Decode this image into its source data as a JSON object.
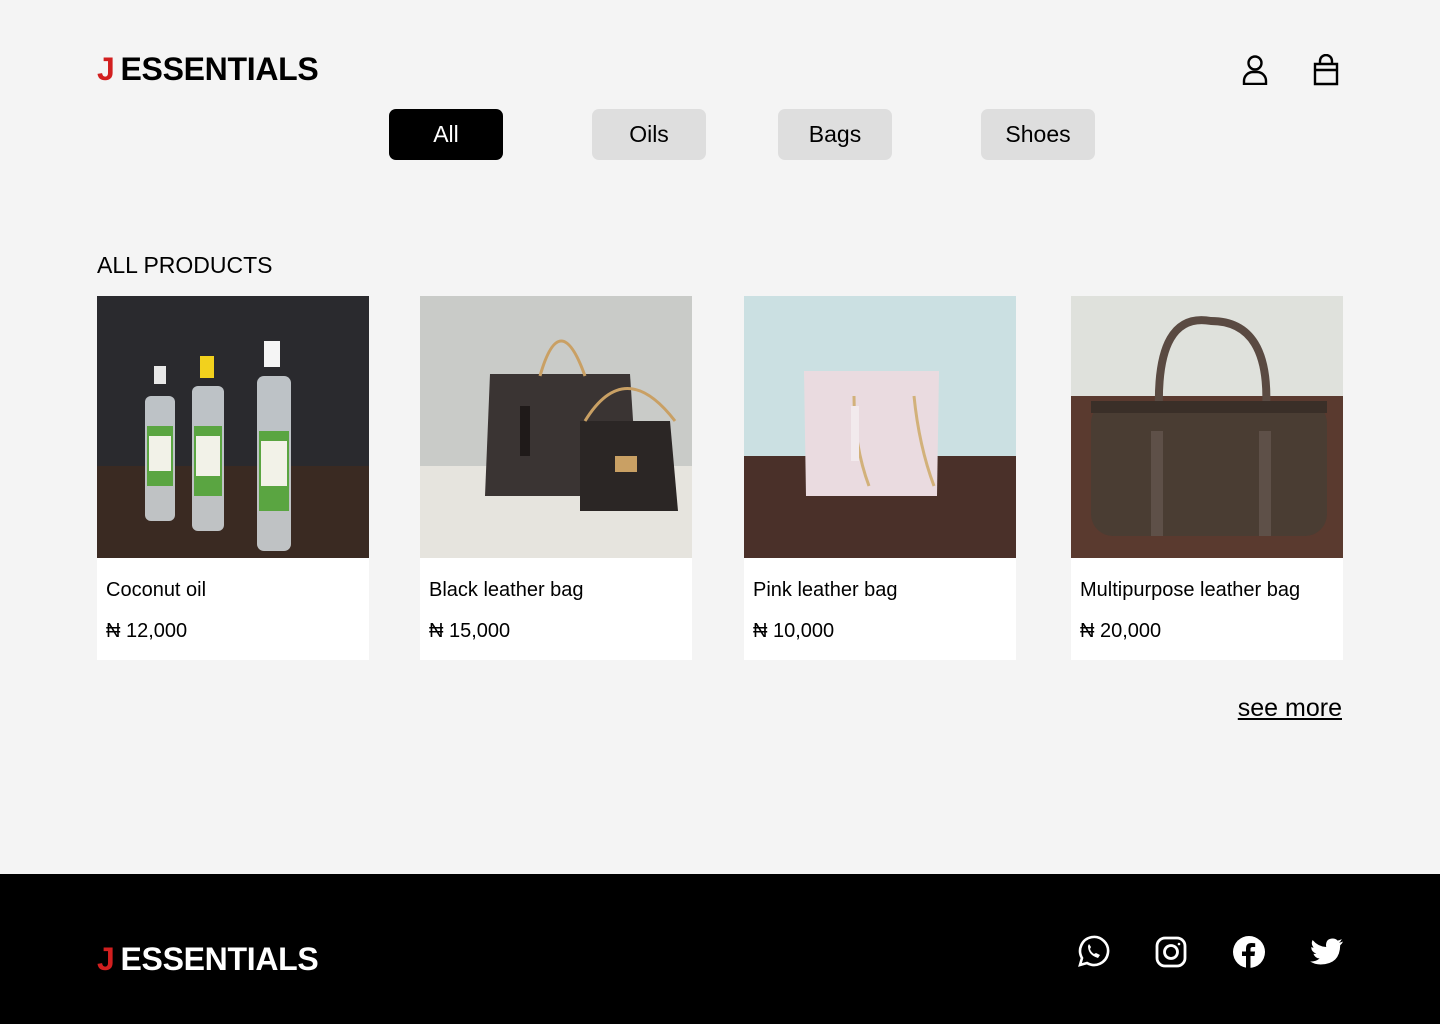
{
  "brand": {
    "initial": "J",
    "name": "ESSENTIALS"
  },
  "header": {
    "icons": [
      "user-icon",
      "shopping-bag-icon"
    ]
  },
  "filters": [
    {
      "label": "All",
      "active": true
    },
    {
      "label": "Oils",
      "active": false
    },
    {
      "label": "Bags",
      "active": false
    },
    {
      "label": "Shoes",
      "active": false
    }
  ],
  "section": {
    "title": "ALL PRODUCTS"
  },
  "products": [
    {
      "name": "Coconut oil",
      "price": "₦ 12,000"
    },
    {
      "name": "Black leather bag",
      "price": "₦ 15,000"
    },
    {
      "name": "Pink leather bag",
      "price": "₦ 10,000"
    },
    {
      "name": "Multipurpose leather bag",
      "price": "₦ 20,000"
    }
  ],
  "see_more": "see more",
  "footer": {
    "social": [
      "whatsapp-icon",
      "instagram-icon",
      "facebook-icon",
      "twitter-icon"
    ]
  },
  "colors": {
    "accent": "#d21f1f",
    "background": "#f4f4f4",
    "footer": "#000000",
    "chip": "#dedede"
  }
}
